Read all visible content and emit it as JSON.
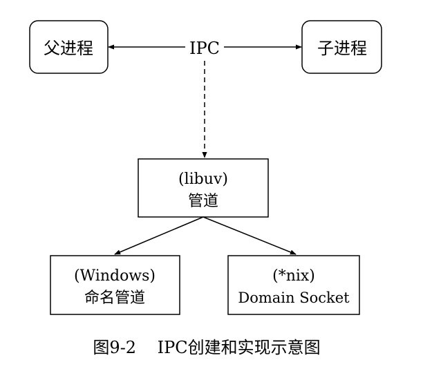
{
  "diagram": {
    "nodes": {
      "parent_process": {
        "label": "父进程"
      },
      "child_process": {
        "label": "子进程"
      },
      "ipc": {
        "label": "IPC"
      },
      "libuv_pipe": {
        "line1": "(libuv)",
        "line2": "管道"
      },
      "windows_pipe": {
        "line1": "(Windows)",
        "line2": "命名管道"
      },
      "nix_socket": {
        "line1": "(*nix)",
        "line2": "Domain Socket"
      }
    },
    "caption": "图9-2    IPC创建和实现示意图"
  },
  "colors": {
    "stroke": "#000000",
    "background": "#ffffff"
  }
}
